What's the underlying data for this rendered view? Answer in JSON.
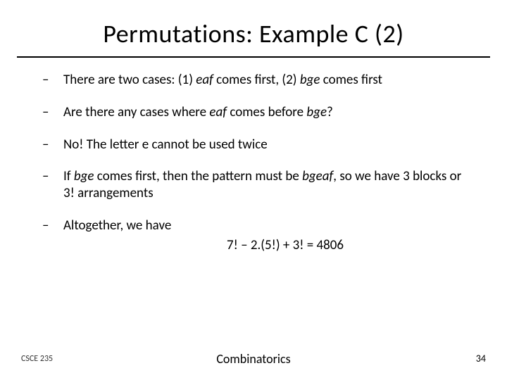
{
  "title": "Permutations: Example C (2)",
  "bullets": {
    "b1_pre": "There are two cases: (1) ",
    "b1_word1": "eaf",
    "b1_mid": " comes first, (2) ",
    "b1_word2": "bge",
    "b1_post": " comes first",
    "b2_pre": "Are there any cases where ",
    "b2_word1": "eaf",
    "b2_mid": " comes before ",
    "b2_word2": "bge",
    "b2_post": "?",
    "b3": "No!  The letter e cannot be used twice",
    "b4_pre": "If ",
    "b4_word1": "bge",
    "b4_mid1": " comes first, then the pattern must be ",
    "b4_word2": "bgeaf",
    "b4_mid2": ", so we have 3 blocks or 3! arrangements",
    "b5": "Altogether, we have"
  },
  "formula": "7! – 2.(5!)  + 3! = 4806",
  "footer": {
    "left": "CSCE 235",
    "center": "Combinatorics",
    "right": "34"
  },
  "dash": "–"
}
